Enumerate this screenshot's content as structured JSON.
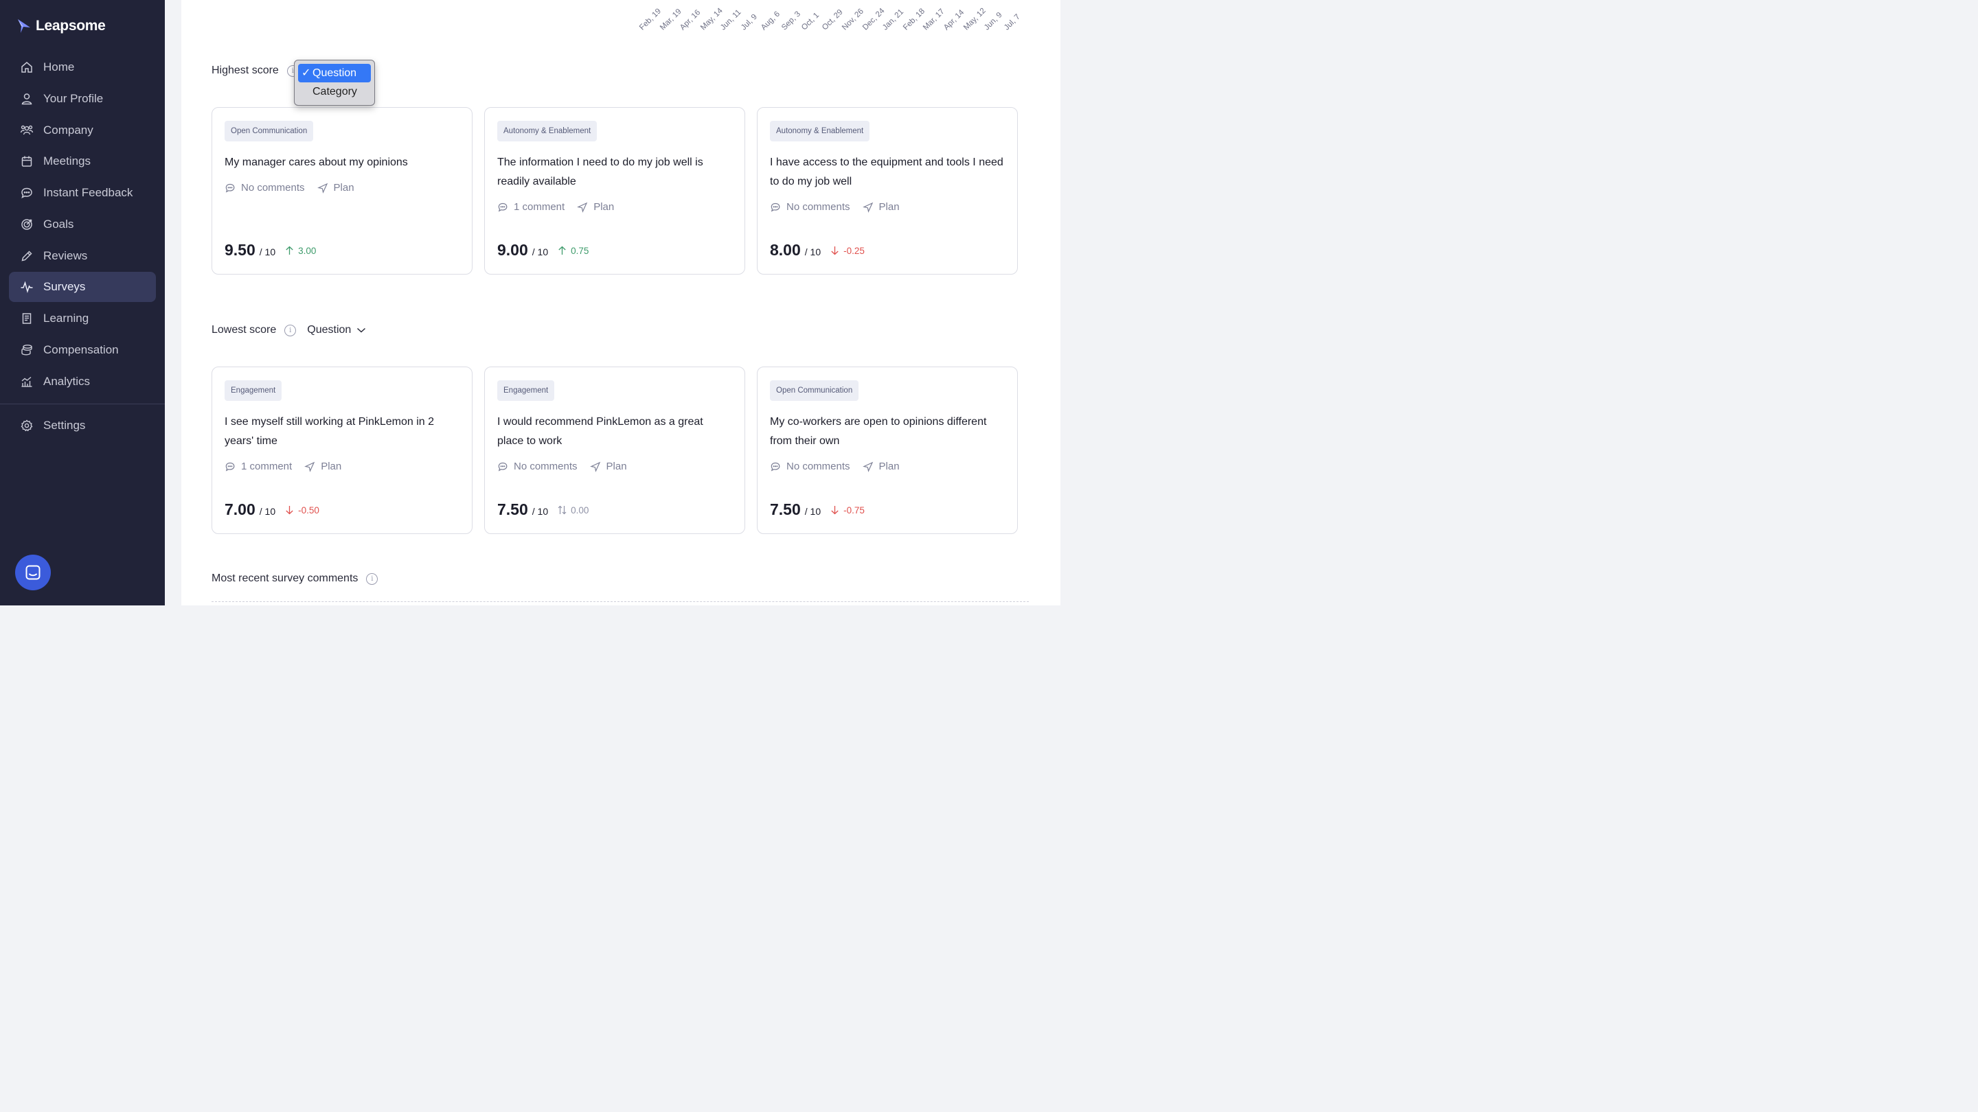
{
  "app": {
    "name": "Leapsome"
  },
  "sidebar": {
    "items": [
      {
        "label": "Home",
        "icon": "home-icon"
      },
      {
        "label": "Your Profile",
        "icon": "user-icon"
      },
      {
        "label": "Company",
        "icon": "people-icon"
      },
      {
        "label": "Meetings",
        "icon": "calendar-icon"
      },
      {
        "label": "Instant Feedback",
        "icon": "chat-icon"
      },
      {
        "label": "Goals",
        "icon": "target-icon"
      },
      {
        "label": "Reviews",
        "icon": "pencil-icon"
      },
      {
        "label": "Surveys",
        "icon": "pulse-icon",
        "active": true
      },
      {
        "label": "Learning",
        "icon": "book-icon"
      },
      {
        "label": "Compensation",
        "icon": "coins-icon"
      },
      {
        "label": "Analytics",
        "icon": "bar-chart-icon"
      }
    ],
    "settings": {
      "label": "Settings",
      "icon": "gear-icon"
    }
  },
  "timeline": {
    "dates": [
      "Feb, 19",
      "Mar, 19",
      "Apr, 16",
      "May, 14",
      "Jun, 11",
      "Jul, 9",
      "Aug, 6",
      "Sep, 3",
      "Oct, 1",
      "Oct, 29",
      "Nov, 26",
      "Dec, 24",
      "Jan, 21",
      "Feb, 18",
      "Mar, 17",
      "Apr, 14",
      "May, 12",
      "Jun, 9",
      "Jul, 7"
    ]
  },
  "highest": {
    "title": "Highest score",
    "dropdown": {
      "options": [
        "Question",
        "Category"
      ],
      "selected": "Question",
      "check": "✓"
    },
    "cards": [
      {
        "tag": "Open Communication",
        "question": "My manager cares about my opinions",
        "comments": "No comments",
        "plan": "Plan",
        "score": "9.50",
        "outof": "/ 10",
        "delta": "3.00",
        "trend": "up"
      },
      {
        "tag": "Autonomy & Enablement",
        "question": "The information I need to do my job well is readily available",
        "comments": "1 comment",
        "plan": "Plan",
        "score": "9.00",
        "outof": "/ 10",
        "delta": "0.75",
        "trend": "up"
      },
      {
        "tag": "Autonomy & Enablement",
        "question": "I have access to the equipment and tools I need to do my job well",
        "comments": "No comments",
        "plan": "Plan",
        "score": "8.00",
        "outof": "/ 10",
        "delta": "-0.25",
        "trend": "down"
      }
    ]
  },
  "lowest": {
    "title": "Lowest score",
    "select_value": "Question",
    "cards": [
      {
        "tag": "Engagement",
        "question": "I see myself still working at PinkLemon in 2 years' time",
        "comments": "1 comment",
        "plan": "Plan",
        "score": "7.00",
        "outof": "/ 10",
        "delta": "-0.50",
        "trend": "down"
      },
      {
        "tag": "Engagement",
        "question": "I would recommend PinkLemon as a great place to work",
        "comments": "No comments",
        "plan": "Plan",
        "score": "7.50",
        "outof": "/ 10",
        "delta": "0.00",
        "trend": "flat"
      },
      {
        "tag": "Open Communication",
        "question": "My co-workers are open to opinions different from their own",
        "comments": "No comments",
        "plan": "Plan",
        "score": "7.50",
        "outof": "/ 10",
        "delta": "-0.75",
        "trend": "down"
      }
    ]
  },
  "recent_comments": {
    "title": "Most recent survey comments"
  },
  "colors": {
    "sidebar_bg": "#212338",
    "active_item": "#363a5c",
    "positive": "#3e9b6b",
    "negative": "#e0514e",
    "launcher": "#3b5bdb"
  }
}
